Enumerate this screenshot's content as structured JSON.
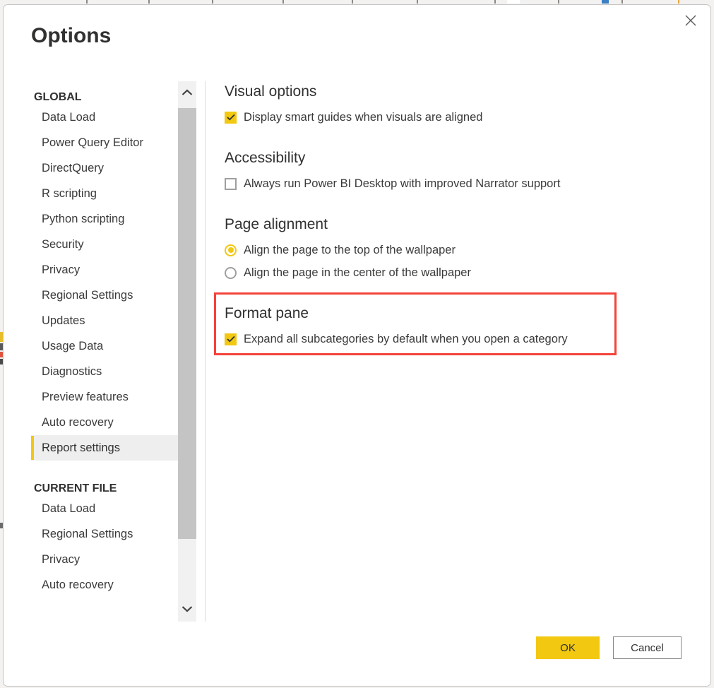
{
  "dialog": {
    "title": "Options",
    "close_icon": "close-icon"
  },
  "sidebar": {
    "groups": [
      {
        "header": "GLOBAL",
        "items": [
          {
            "label": "Data Load",
            "selected": false
          },
          {
            "label": "Power Query Editor",
            "selected": false
          },
          {
            "label": "DirectQuery",
            "selected": false
          },
          {
            "label": "R scripting",
            "selected": false
          },
          {
            "label": "Python scripting",
            "selected": false
          },
          {
            "label": "Security",
            "selected": false
          },
          {
            "label": "Privacy",
            "selected": false
          },
          {
            "label": "Regional Settings",
            "selected": false
          },
          {
            "label": "Updates",
            "selected": false
          },
          {
            "label": "Usage Data",
            "selected": false
          },
          {
            "label": "Diagnostics",
            "selected": false
          },
          {
            "label": "Preview features",
            "selected": false
          },
          {
            "label": "Auto recovery",
            "selected": false
          },
          {
            "label": "Report settings",
            "selected": true
          }
        ]
      },
      {
        "header": "CURRENT FILE",
        "items": [
          {
            "label": "Data Load",
            "selected": false
          },
          {
            "label": "Regional Settings",
            "selected": false
          },
          {
            "label": "Privacy",
            "selected": false
          },
          {
            "label": "Auto recovery",
            "selected": false
          }
        ]
      }
    ],
    "scrollbar": {
      "up_arrow_icon": "chevron-up-icon",
      "down_arrow_icon": "chevron-down-icon"
    }
  },
  "content": {
    "sections": [
      {
        "heading": "Visual options",
        "options": [
          {
            "type": "checkbox",
            "checked": true,
            "label": "Display smart guides when visuals are aligned"
          }
        ]
      },
      {
        "heading": "Accessibility",
        "options": [
          {
            "type": "checkbox",
            "checked": false,
            "label": "Always run Power BI Desktop with improved Narrator support"
          }
        ]
      },
      {
        "heading": "Page alignment",
        "options": [
          {
            "type": "radio",
            "selected": true,
            "label": "Align the page to the top of the wallpaper"
          },
          {
            "type": "radio",
            "selected": false,
            "label": "Align the page in the center of the wallpaper"
          }
        ]
      },
      {
        "heading": "Format pane",
        "highlighted": true,
        "options": [
          {
            "type": "checkbox",
            "checked": true,
            "label": "Expand all subcategories by default when you open a category"
          }
        ]
      }
    ]
  },
  "footer": {
    "ok_label": "OK",
    "cancel_label": "Cancel"
  },
  "colors": {
    "accent": "#f2c811",
    "annotation": "#f4433a",
    "text": "#323130",
    "muted_text": "#3b3a39",
    "selected_nav_bg": "#eeeeee",
    "scrollbar_thumb": "#c4c4c4",
    "scrollbar_track": "#f1f1f1",
    "border": "#c8c6c4"
  }
}
